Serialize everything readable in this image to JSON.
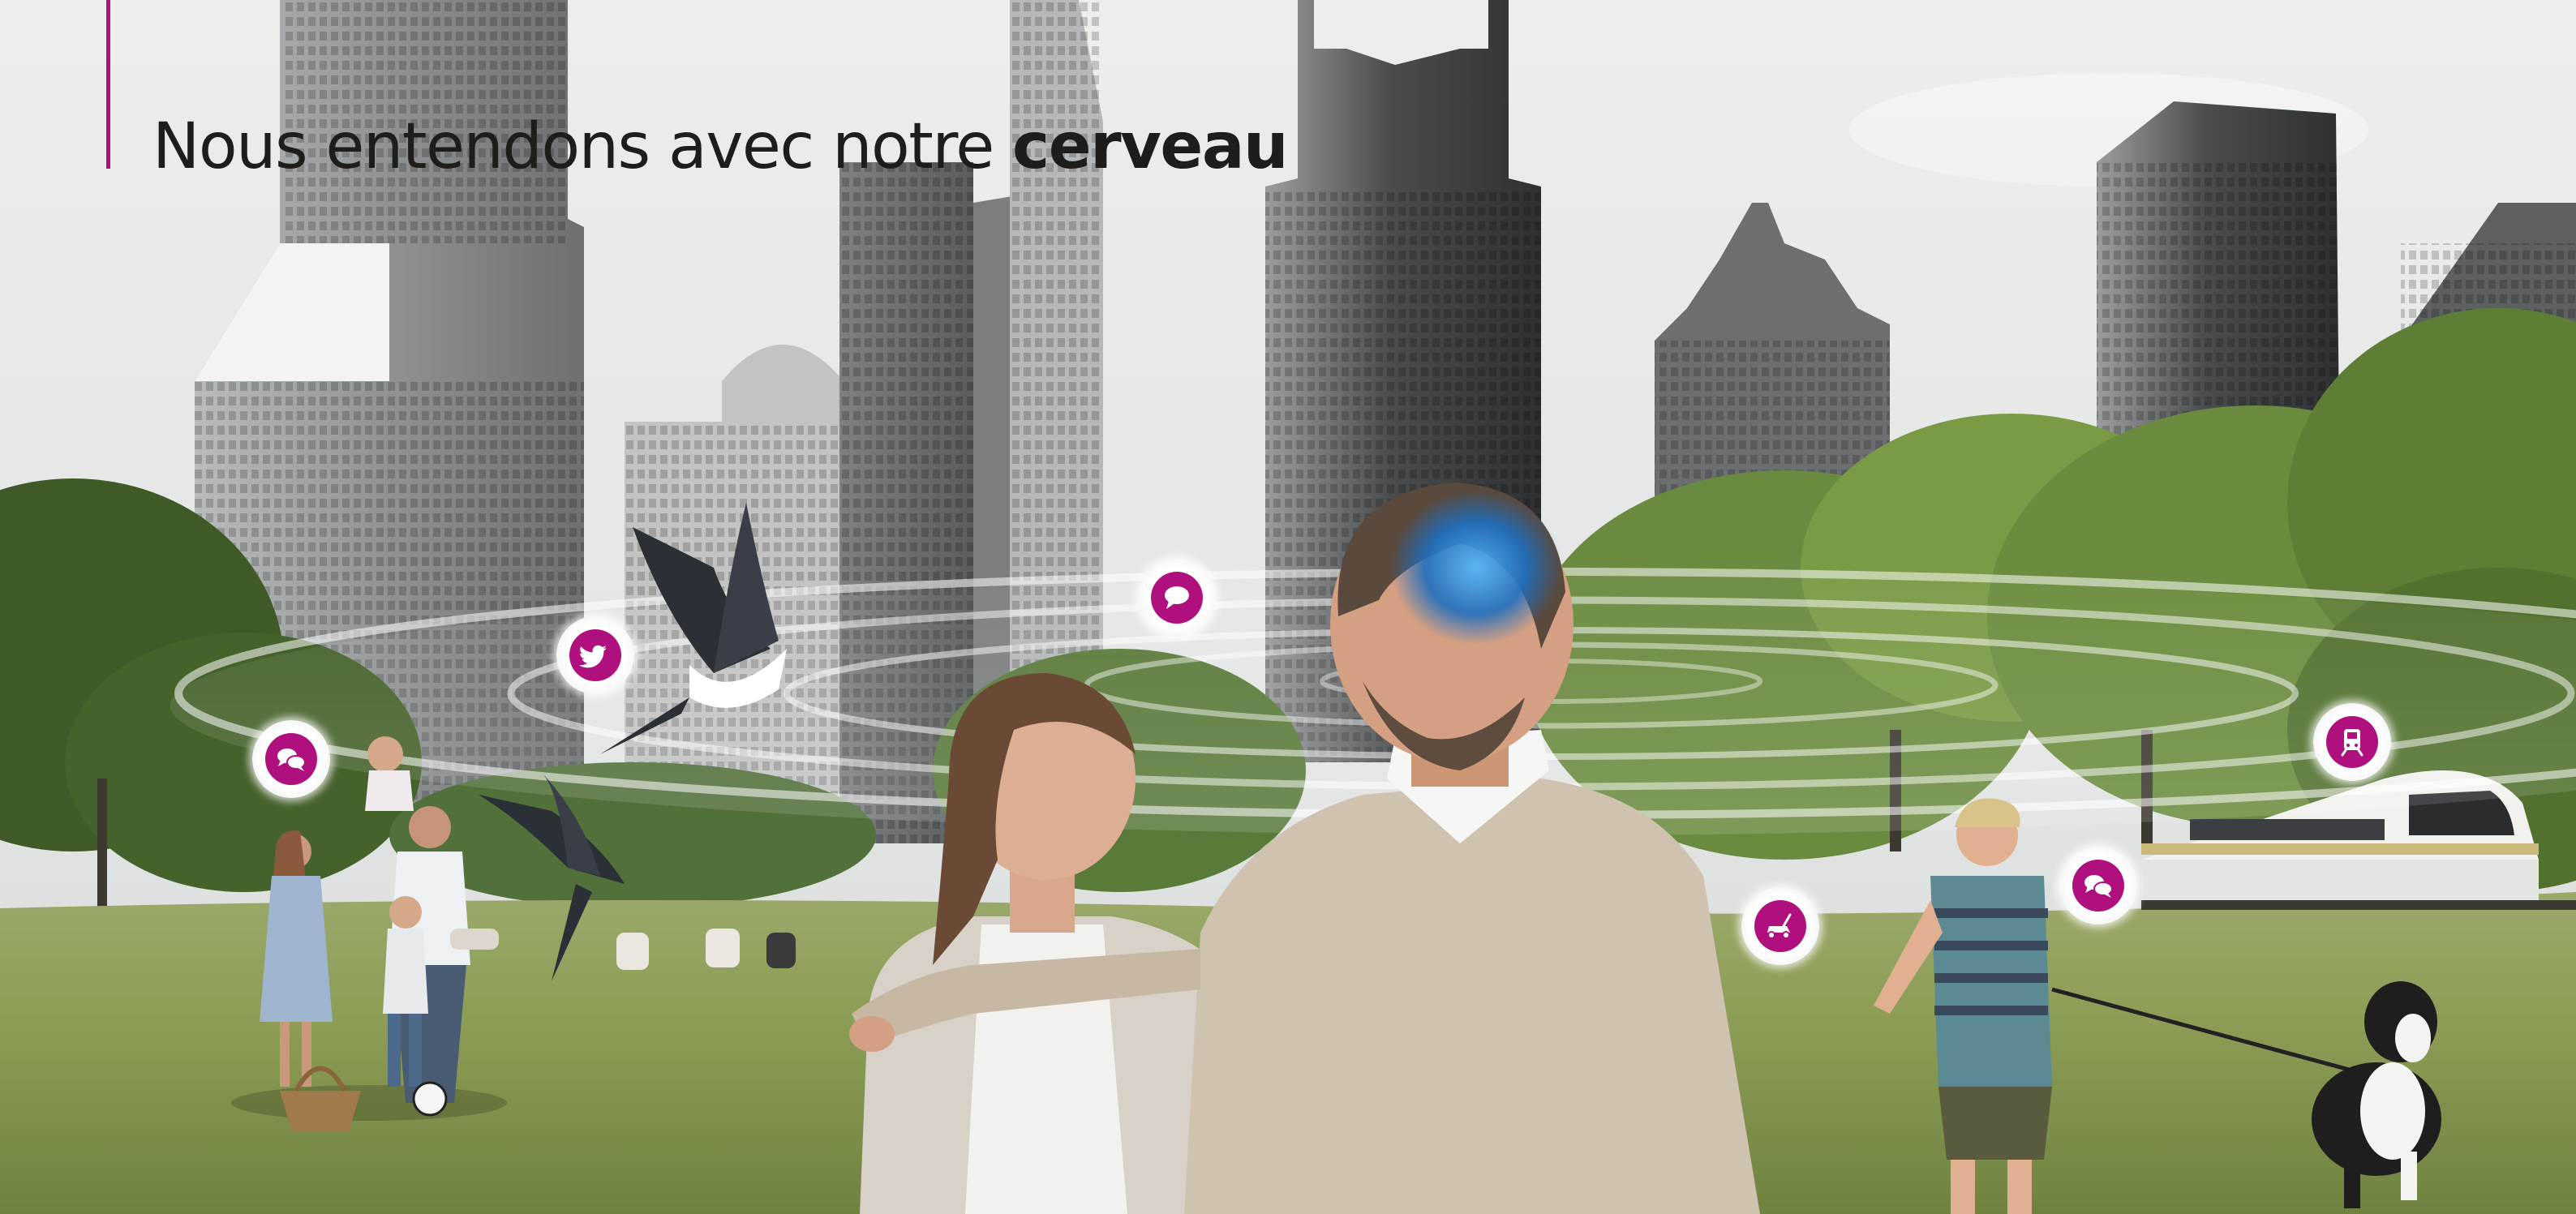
{
  "headline": {
    "regular": "Nous entendons avec notre ",
    "bold": "cerveau"
  },
  "colors": {
    "accent": "#b0107e",
    "sky": "#e4e7e6",
    "grass": "#8e9f55",
    "text": "#1d1d1b"
  },
  "sound_icons": [
    "twitter-bird-icon",
    "speech-bubble-icon",
    "chat-bubbles-icon",
    "chat-bubbles-icon",
    "train-icon",
    "lawnmower-icon"
  ]
}
